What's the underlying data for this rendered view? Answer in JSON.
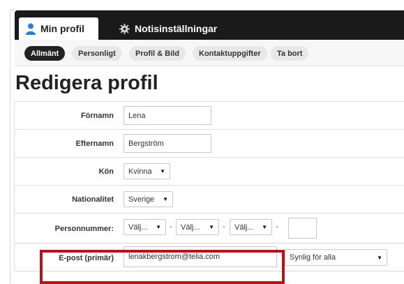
{
  "main_tabs": [
    {
      "label": "Min profil",
      "icon": "person-icon",
      "active": true
    },
    {
      "label": "Notisinställningar",
      "icon": "gear-icon",
      "active": false
    }
  ],
  "sub_tabs": [
    {
      "label": "Allmänt",
      "active": true
    },
    {
      "label": "Personligt",
      "active": false
    },
    {
      "label": "Profil & Bild",
      "active": false
    },
    {
      "label": "Kontaktuppgifter",
      "active": false
    },
    {
      "label": "Ta bort",
      "active": false
    }
  ],
  "page_title": "Redigera profil",
  "form": {
    "first_name": {
      "label": "Förnamn",
      "value": "Lena"
    },
    "last_name": {
      "label": "Efternamn",
      "value": "Bergström"
    },
    "gender": {
      "label": "Kön",
      "value": "Kvinna"
    },
    "nationality": {
      "label": "Nationalitet",
      "value": "Sverige"
    },
    "personal_number": {
      "label": "Personnummer:",
      "year": "Välj...",
      "month": "Välj...",
      "day": "Välj...",
      "separator": "-",
      "last_digits": ""
    },
    "email": {
      "label": "E-post (primär)",
      "value": "lenakbergstrom@telia.com",
      "visibility": "Synlig för alla"
    }
  },
  "colors": {
    "accent_blue": "#2a7fd4",
    "tab_bar": "#1a1a1a",
    "highlight": "#b4151b"
  }
}
